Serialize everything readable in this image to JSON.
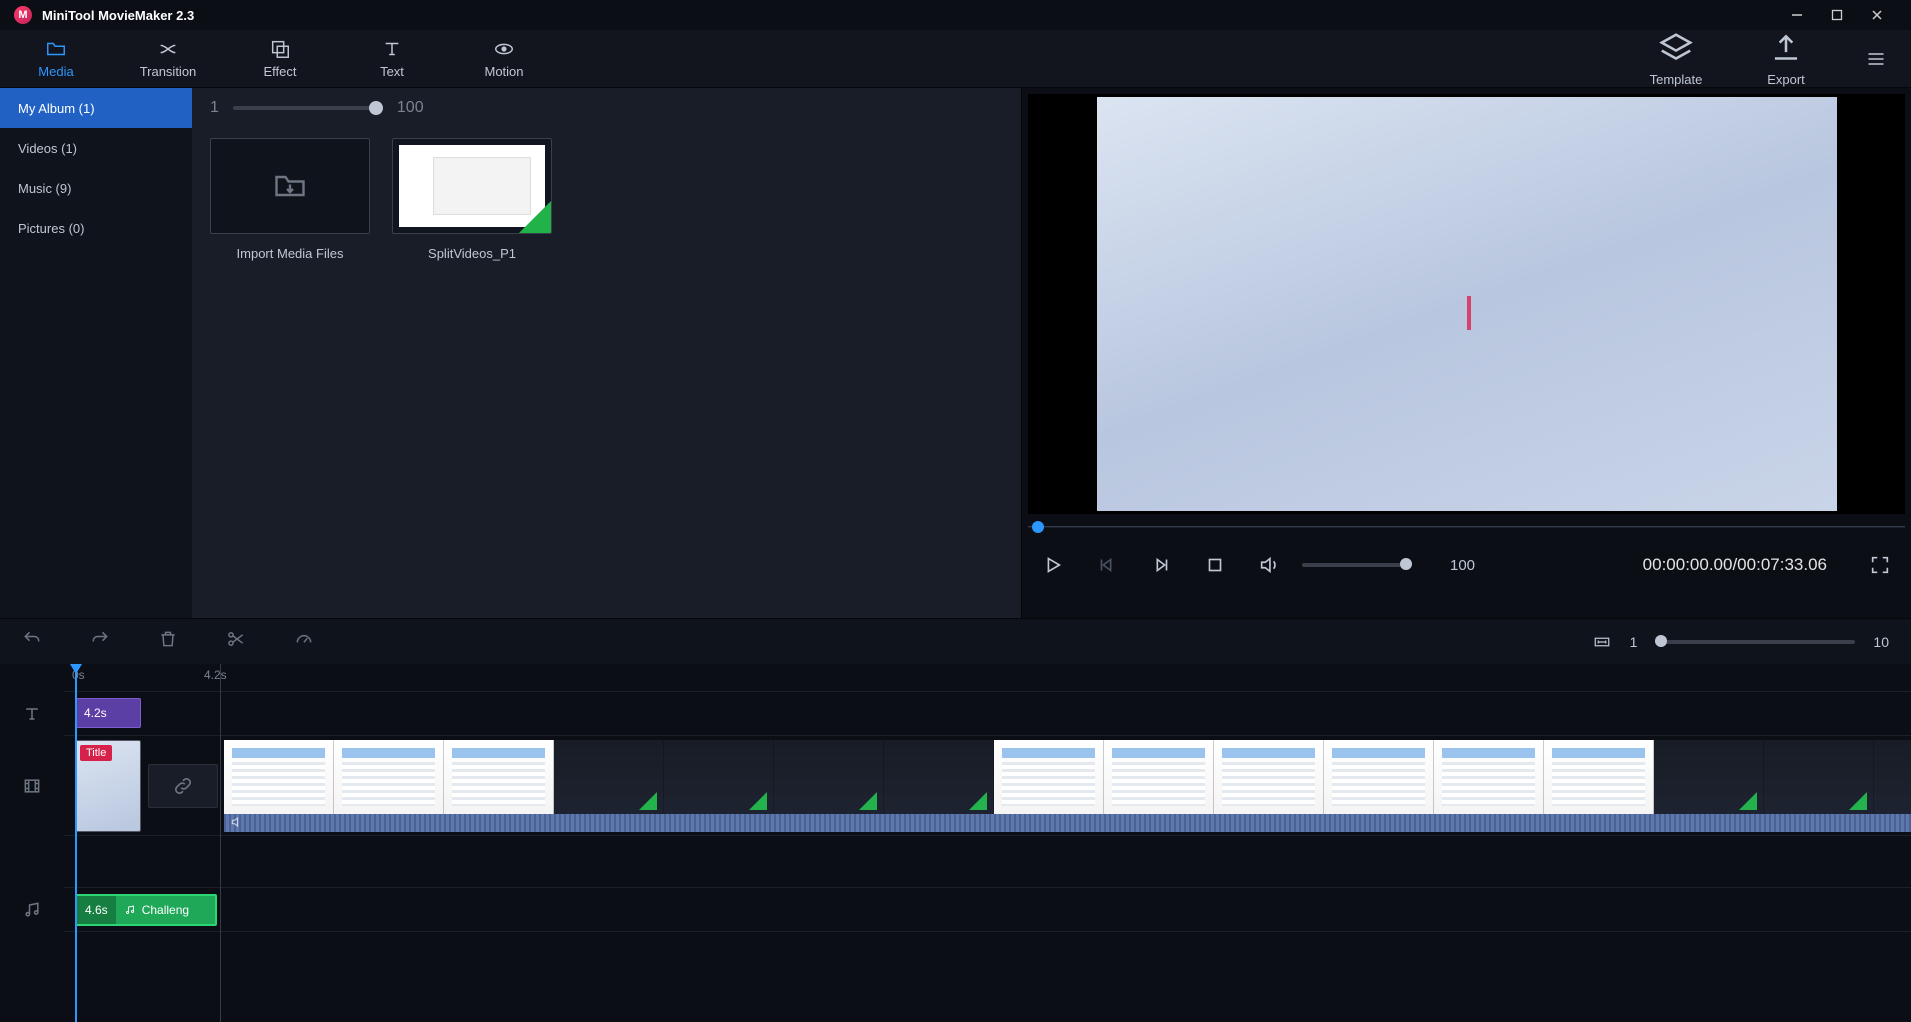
{
  "app": {
    "title": "MiniTool MovieMaker 2.3"
  },
  "toptabs": {
    "media": "Media",
    "transition": "Transition",
    "effect": "Effect",
    "text": "Text",
    "motion": "Motion",
    "template": "Template",
    "export": "Export"
  },
  "sidebar": {
    "items": [
      {
        "label": "My Album  (1)"
      },
      {
        "label": "Videos  (1)"
      },
      {
        "label": "Music  (9)"
      },
      {
        "label": "Pictures  (0)"
      }
    ]
  },
  "media_header": {
    "zoom_min": "1",
    "zoom_max": "100"
  },
  "media_cards": {
    "import": "Import Media Files",
    "clip1": "SplitVideos_P1"
  },
  "preview": {
    "volume_label": "100",
    "timecode": "00:00:00.00/00:07:33.06"
  },
  "tl_toolbar": {
    "zoom_min": "1",
    "zoom_max": "10"
  },
  "ruler": {
    "t0": "0s",
    "t1": "4.2s"
  },
  "clips": {
    "title_dur": "4.2s",
    "intro_badge": "Title",
    "music_dur": "4.6s",
    "music_name": "Challeng"
  }
}
